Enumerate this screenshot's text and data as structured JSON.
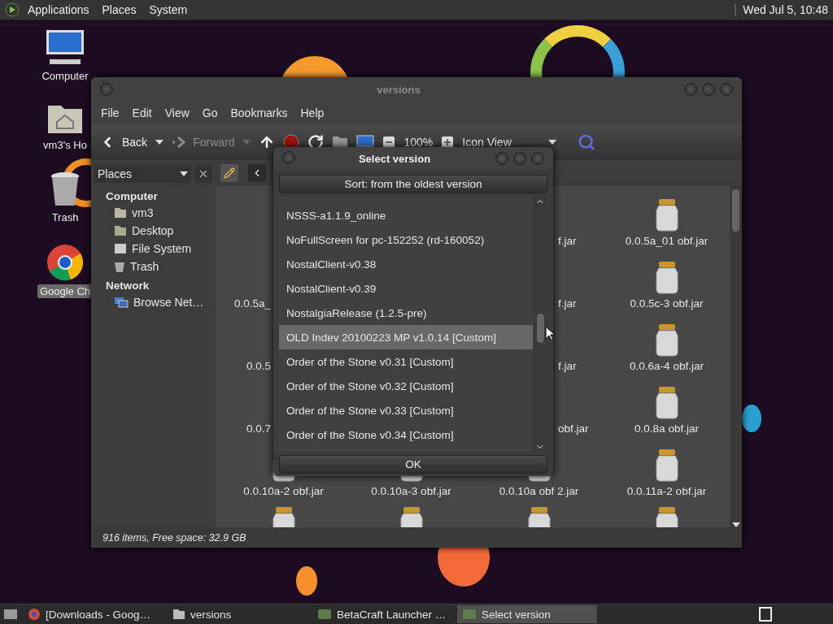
{
  "top_panel": {
    "menus": [
      "Applications",
      "Places",
      "System"
    ],
    "clock": "Wed Jul 5, 10:48"
  },
  "desktop_icons": [
    {
      "label": "Computer",
      "kind": "computer",
      "selected": false
    },
    {
      "label": "vm3's Ho",
      "kind": "home",
      "selected": false
    },
    {
      "label": "Trash",
      "kind": "trash",
      "selected": false
    },
    {
      "label": "Google Ch",
      "kind": "browser",
      "selected": true
    }
  ],
  "file_manager": {
    "title": "versions",
    "menu": [
      "File",
      "Edit",
      "View",
      "Go",
      "Bookmarks",
      "Help"
    ],
    "toolbar": {
      "back": "Back",
      "forward": "Forward",
      "forward_disabled": true,
      "zoom": "100%",
      "view": "Icon View"
    },
    "sidebar": {
      "selector": "Places",
      "sections": [
        {
          "heading": "Computer",
          "items": [
            {
              "label": "vm3",
              "kind": "home"
            },
            {
              "label": "Desktop",
              "kind": "desktop"
            },
            {
              "label": "File System",
              "kind": "drive"
            },
            {
              "label": "Trash",
              "kind": "trash"
            }
          ]
        },
        {
          "heading": "Network",
          "items": [
            {
              "label": "Browse Net…",
              "kind": "network"
            }
          ]
        }
      ]
    },
    "files": [
      {
        "kind": "hidden"
      },
      {
        "kind": "hidden"
      },
      {
        "kind": "cut_right",
        "label": "f.jar"
      },
      {
        "kind": "full",
        "label": "0.0.5a_01 obf.jar"
      },
      {
        "kind": "cut_left",
        "label": "0.0.5a_"
      },
      {
        "kind": "hidden"
      },
      {
        "kind": "cut_right",
        "label": "f.jar"
      },
      {
        "kind": "full",
        "label": "0.0.5c-3 obf.jar"
      },
      {
        "kind": "cut_left",
        "label": "0.0.5"
      },
      {
        "kind": "hidden"
      },
      {
        "kind": "cut_right",
        "label": "f.jar"
      },
      {
        "kind": "full",
        "label": "0.0.6a-4 obf.jar"
      },
      {
        "kind": "cut_left",
        "label": "0.0.7"
      },
      {
        "kind": "hidden"
      },
      {
        "kind": "cut_right",
        "label": "obf.jar"
      },
      {
        "kind": "full",
        "label": "0.0.8a obf.jar"
      },
      {
        "kind": "full",
        "label": "0.0.10a-2 obf.jar"
      },
      {
        "kind": "full",
        "label": "0.0.10a-3 obf.jar"
      },
      {
        "kind": "full",
        "label": "0.0.10a obf 2.jar"
      },
      {
        "kind": "full",
        "label": "0.0.11a-2 obf.jar"
      },
      {
        "kind": "icon_only"
      },
      {
        "kind": "icon_only"
      },
      {
        "kind": "icon_only"
      },
      {
        "kind": "icon_only"
      }
    ],
    "status": "916 items, Free space: 32.9 GB"
  },
  "dialog": {
    "title": "Select version",
    "sort": "Sort: from the oldest version",
    "versions": [
      {
        "label": "NSSS-a1.1.9_online",
        "selected": false
      },
      {
        "label": "NoFullScreen for pc-152252 (rd-160052)",
        "selected": false
      },
      {
        "label": "NostalClient-v0.38",
        "selected": false
      },
      {
        "label": "NostalClient-v0.39",
        "selected": false
      },
      {
        "label": "NostalgiaRelease (1.2.5-pre)",
        "selected": false
      },
      {
        "label": "OLD Indev 20100223 MP v1.0.14 [Custom]",
        "selected": true
      },
      {
        "label": "Order of the Stone v0.31 [Custom]",
        "selected": false
      },
      {
        "label": "Order of the Stone v0.32 [Custom]",
        "selected": false
      },
      {
        "label": "Order of the Stone v0.33 [Custom]",
        "selected": false
      },
      {
        "label": "Order of the Stone v0.34 [Custom]",
        "selected": false
      }
    ],
    "ok": "OK"
  },
  "taskbar": {
    "items": [
      {
        "label": "[Downloads - Goog…",
        "kind": "browser",
        "selected": false
      },
      {
        "label": "versions",
        "kind": "folder",
        "selected": false
      },
      {
        "label": "BetaCraft Launcher …",
        "kind": "launcher",
        "selected": false
      },
      {
        "label": "Select version",
        "kind": "launcher",
        "selected": true
      }
    ]
  }
}
